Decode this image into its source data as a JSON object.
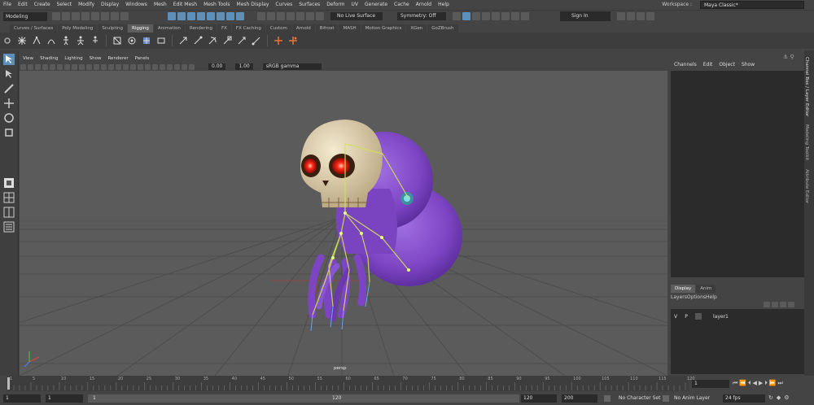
{
  "menubar": [
    "File",
    "Edit",
    "Create",
    "Select",
    "Modify",
    "Display",
    "Windows",
    "Mesh",
    "Edit Mesh",
    "Mesh Tools",
    "Mesh Display",
    "Curves",
    "Surfaces",
    "Deform",
    "UV",
    "Generate",
    "Cache",
    "Arnold",
    "Help"
  ],
  "workspace": {
    "label": "Workspace :",
    "value": "Maya Classic*"
  },
  "status": {
    "mode": "Modeling",
    "live_surface": "No Live Surface",
    "symmetry": "Symmetry: Off",
    "signin": "Sign In"
  },
  "shelf_tabs": [
    "Curves / Surfaces",
    "Poly Modeling",
    "Sculpting",
    "Rigging",
    "Animation",
    "Rendering",
    "FX",
    "FX Caching",
    "Custom",
    "Arnold",
    "Bifrost",
    "MASH",
    "Motion Graphics",
    "XGen",
    "GoZBrush"
  ],
  "shelf_active": "Rigging",
  "viewport": {
    "menu": [
      "View",
      "Shading",
      "Lighting",
      "Show",
      "Renderer",
      "Panels"
    ],
    "exposure": "0.00",
    "gamma": "1.00",
    "colorspace": "sRGB gamma",
    "camera": "persp"
  },
  "channel_box": {
    "menu": [
      "Channels",
      "Edit",
      "Object",
      "Show"
    ],
    "side_labels": [
      "Channel Box / Layer Editor",
      "Modeling Toolkit",
      "Attribute Editor"
    ]
  },
  "layers": {
    "tabs": [
      "Display",
      "Anim"
    ],
    "menu": [
      "Layers",
      "Options",
      "Help"
    ],
    "row": {
      "v": "V",
      "p": "P",
      "name": "layer1"
    }
  },
  "time_slider": {
    "ticks": [
      "1",
      "5",
      "10",
      "15",
      "20",
      "25",
      "30",
      "35",
      "40",
      "45",
      "50",
      "55",
      "60",
      "65",
      "70",
      "75",
      "80",
      "85",
      "90",
      "95",
      "100",
      "105",
      "110",
      "115",
      "120"
    ],
    "current": "1"
  },
  "range": {
    "start": "1",
    "inner_start": "1",
    "inner_end": "120",
    "end": "120",
    "max": "200",
    "character_set": "No Character Set",
    "anim_layer": "No Anim Layer",
    "fps": "24 fps"
  },
  "colors": {
    "bg": "#444444",
    "viewport": "#5b5b5b",
    "accent": "#5d8fb8",
    "creature": "#8a4fc9",
    "skull": "#e8dcc0",
    "eyes": "#ff2a1a"
  }
}
